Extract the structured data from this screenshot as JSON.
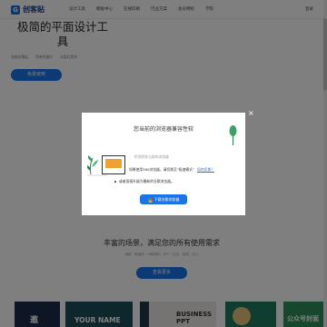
{
  "header": {
    "logo_mark": "G",
    "logo_text": "创客贴",
    "nav": [
      "设计工具",
      "模板中心",
      "在线印刷",
      "行业方案",
      "会员特权",
      "学院"
    ],
    "login": "登录"
  },
  "hero": {
    "title": "极简的平面设计工具",
    "subtitles": [
      "海量的模板",
      "简单的操作",
      "丰富的素材"
    ],
    "cta": "免费使用"
  },
  "scenes": {
    "title": "丰富的场景，满足您的所有使用需求",
    "subtitle": "海报 · 新媒体 · 印刷物料 · PPT · 社交 · 电商 · 办公",
    "cta": "查看更多",
    "templates": {
      "tpl1": "邀",
      "tpl2": "YOUR NAME",
      "tpl3": "BUSINESS PPT",
      "tpl5": "公众号封面"
    }
  },
  "modal": {
    "title": "您当前的浏览器兼容性较",
    "line1": "检测到你当前的浏览器",
    "line2": "如果使用360浏览器，请切换至“极速模式”",
    "link": "如何切换？",
    "bullet": "或者直接升级为最新的谷歌浏览器。",
    "download": "下载谷歌浏览器",
    "close": "×"
  },
  "colors": {
    "brand": "#1a73e8",
    "overlay": "rgba(0,0,0,0.5)"
  }
}
